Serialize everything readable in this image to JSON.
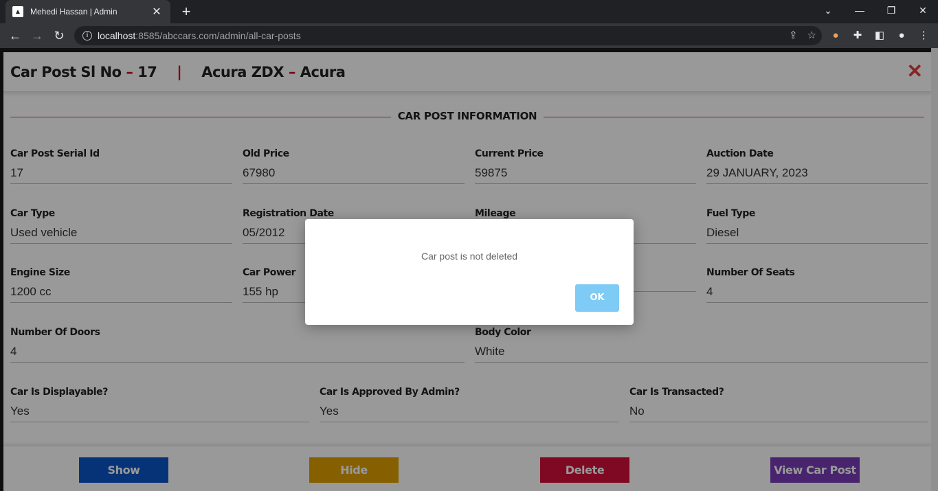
{
  "browser": {
    "tab_title": "Mehedi Hassan | Admin",
    "url_host": "localhost",
    "url_rest": ":8585/abccars.com/admin/all-car-posts"
  },
  "modal": {
    "title_prefix": "Car Post Sl No",
    "dash1": "–",
    "serial": "17",
    "separator": "|",
    "car_name": "Acura ZDX",
    "dash2": "–",
    "make": "Acura",
    "section_title": "CAR POST INFORMATION",
    "fields": {
      "serial_id": {
        "label": "Car Post Serial Id",
        "value": "17"
      },
      "old_price": {
        "label": "Old Price",
        "value": "67980"
      },
      "current_price": {
        "label": "Current Price",
        "value": "59875"
      },
      "auction_date": {
        "label": "Auction Date",
        "value": "29 JANUARY, 2023"
      },
      "car_type": {
        "label": "Car Type",
        "value": "Used vehicle"
      },
      "registration_date": {
        "label": "Registration Date",
        "value": "05/2012"
      },
      "mileage": {
        "label": "Mileage",
        "value": ""
      },
      "fuel_type": {
        "label": "Fuel Type",
        "value": "Diesel"
      },
      "engine_size": {
        "label": "Engine Size",
        "value": "1200 cc"
      },
      "car_power": {
        "label": "Car Power",
        "value": "155 hp"
      },
      "transmission": {
        "label": "",
        "value": ""
      },
      "seats": {
        "label": "Number Of Seats",
        "value": "4"
      },
      "doors": {
        "label": "Number Of Doors",
        "value": "4"
      },
      "body_color": {
        "label": "Body Color",
        "value": "White"
      },
      "displayable": {
        "label": "Car Is Displayable?",
        "value": "Yes"
      },
      "approved": {
        "label": "Car Is Approved By Admin?",
        "value": "Yes"
      },
      "transacted": {
        "label": "Car Is Transacted?",
        "value": "No"
      }
    },
    "actions": {
      "show": "Show",
      "hide": "Hide",
      "delete": "Delete",
      "view": "View Car Post"
    }
  },
  "alert": {
    "message": "Car post is not deleted",
    "ok_label": "OK"
  },
  "colors": {
    "show": "#0b56c8",
    "hide": "#e0a000",
    "delete": "#d4103a",
    "view": "#7a3db8",
    "ok": "#7ecbf5"
  }
}
